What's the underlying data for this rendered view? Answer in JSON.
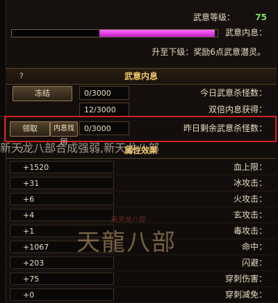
{
  "top_info": {
    "level_label": "武意等级：",
    "level_value": "75",
    "inner_label": "武意内息：",
    "next_level_text": "升至下级：奖励6点武意潜灵。"
  },
  "inner_section": {
    "title": "武意内息",
    "side_mark": "?",
    "rows": [
      {
        "button": "冻结",
        "count": "0/3000",
        "label": "今日武意杀怪数："
      },
      {
        "button": "",
        "count": "12/3000",
        "label": "双倍内息获得："
      },
      {
        "button": "内息找回",
        "count": "0/3000",
        "label": "昨日剩余武意杀怪数："
      }
    ],
    "left_button": "领取"
  },
  "banner_text": "新天龙八部合成强弱,新天龙八部",
  "attr_section": {
    "title": "属性效果",
    "side_mark": "?",
    "rows": [
      {
        "value": "+1520",
        "name": "血上限："
      },
      {
        "value": "+31",
        "name": "冰攻击："
      },
      {
        "value": "+6",
        "name": "火攻击："
      },
      {
        "value": "+4",
        "name": "玄攻击："
      },
      {
        "value": "+1",
        "name": "毒攻击："
      },
      {
        "value": "+1067",
        "name": "命中："
      },
      {
        "value": "+203",
        "name": "闪避："
      },
      {
        "value": "+75",
        "name": "穿刺伤害："
      },
      {
        "value": "+0",
        "name": "穿刺减免："
      }
    ]
  },
  "watermark": {
    "main": "天龍八部",
    "sub": "新天龙八部"
  },
  "colors": {
    "accent": "#f0c76a",
    "level": "#7be05b",
    "bar": "#d43ad8",
    "highlight": "#d42020"
  }
}
